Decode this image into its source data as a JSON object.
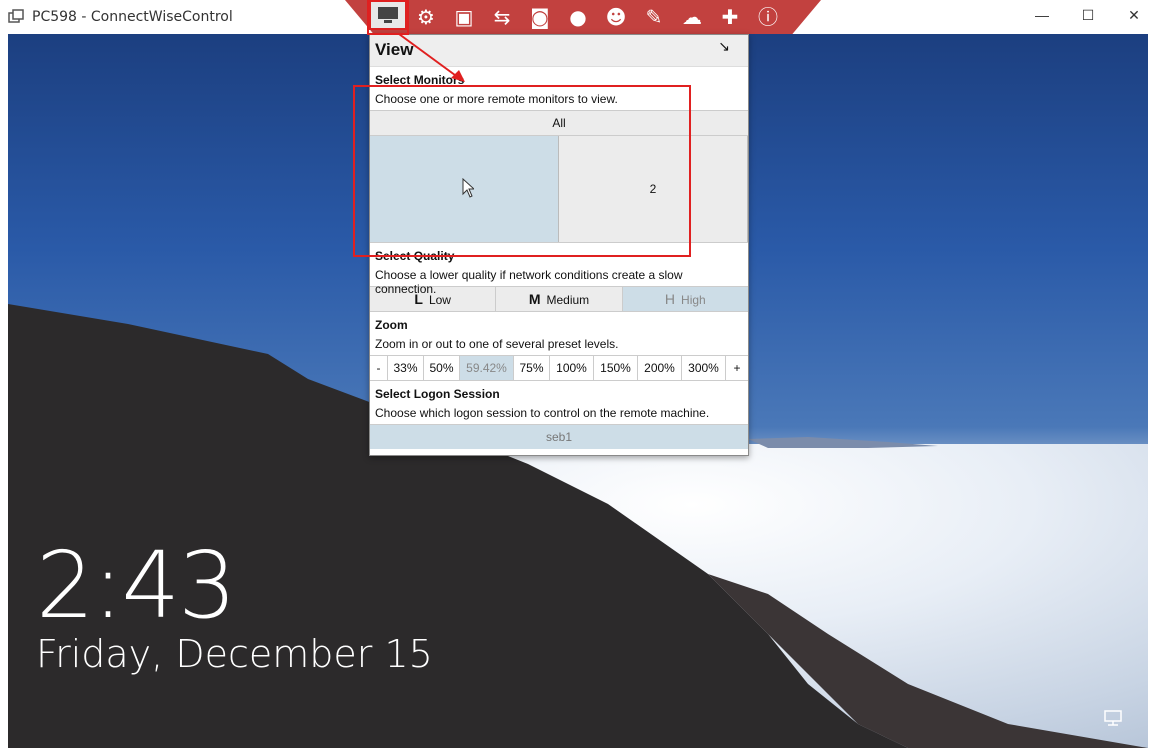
{
  "window": {
    "title": "PC598 - ConnectWiseControl",
    "minimize": "—",
    "maximize": "☐",
    "close": "✕"
  },
  "toolbar": {
    "items": [
      {
        "name": "view-monitor-icon",
        "glyph": "▀"
      },
      {
        "name": "gear-icon",
        "glyph": "⚙"
      },
      {
        "name": "toolbox-icon",
        "glyph": "▣"
      },
      {
        "name": "transfer-icon",
        "glyph": "⇆"
      },
      {
        "name": "camera-icon",
        "glyph": "◙"
      },
      {
        "name": "microphone-icon",
        "glyph": "●"
      },
      {
        "name": "users-icon",
        "glyph": "☻"
      },
      {
        "name": "pencil-icon",
        "glyph": "✎"
      },
      {
        "name": "chat-icon",
        "glyph": "☁"
      },
      {
        "name": "plus-icon",
        "glyph": "✚"
      },
      {
        "name": "info-icon",
        "glyph": "ⓘ"
      }
    ]
  },
  "panel": {
    "title": "View",
    "expand_glyph": "↘",
    "monitors": {
      "title": "Select Monitors",
      "desc": "Choose one or more remote monitors to view.",
      "all_label": "All",
      "monitor_1_label": "",
      "monitor_2_label": "2"
    },
    "quality": {
      "title": "Select Quality",
      "desc": "Choose a lower quality if network conditions create a slow connection.",
      "options": [
        {
          "letter": "L",
          "label": "Low"
        },
        {
          "letter": "M",
          "label": "Medium"
        },
        {
          "letter": "H",
          "label": "High"
        }
      ],
      "selected": "High"
    },
    "zoom": {
      "title": "Zoom",
      "desc": "Zoom in or out to one of several preset levels.",
      "levels": [
        "-",
        "33%",
        "50%",
        "59.42%",
        "75%",
        "100%",
        "150%",
        "200%",
        "300%",
        "+"
      ],
      "selected": "59.42%"
    },
    "logon": {
      "title": "Select Logon Session",
      "desc": "Choose which logon session to control on the remote machine.",
      "session": "seb1"
    }
  },
  "lockscreen": {
    "time": "2:43",
    "date": "Friday, December 15"
  },
  "colors": {
    "toolbar": "#c2413f",
    "selected": "#cddde7",
    "highlight": "#e02020"
  }
}
